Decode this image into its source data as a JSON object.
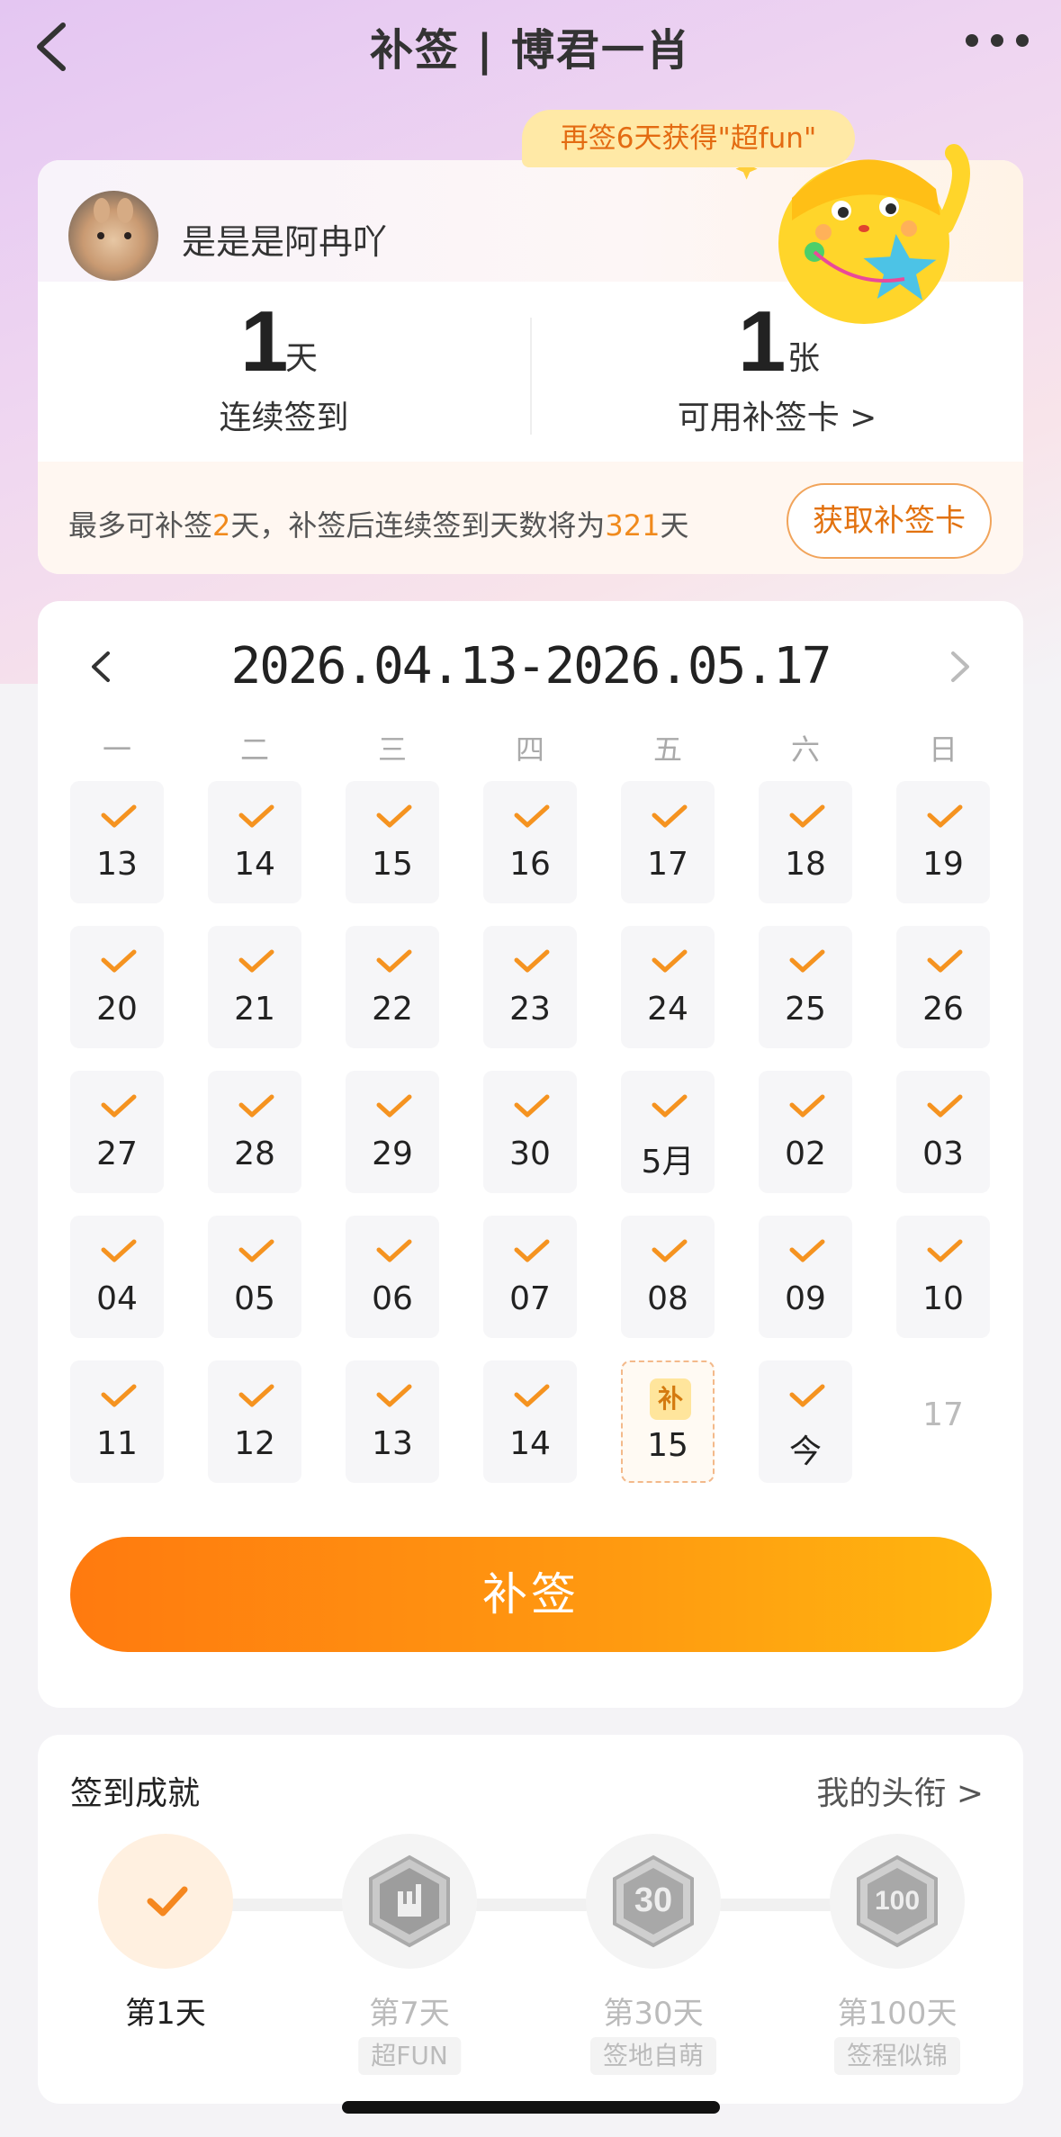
{
  "nav": {
    "title": "补签 | 博君一肖"
  },
  "promo": {
    "text": "再签6天获得\"超fun\""
  },
  "profile": {
    "username": "是是是阿冉吖",
    "streak_value": "1",
    "streak_unit": "天",
    "streak_label": "连续签到",
    "cards_value": "1",
    "cards_unit": "张",
    "cards_label": "可用补签卡 >"
  },
  "hint": {
    "p1": "最多可补签",
    "days": "2",
    "p2": "天，补签后连续签到天数将为",
    "total": "321",
    "p3": "天",
    "button": "获取补签卡"
  },
  "calendar": {
    "range": "2026.04.13-2026.05.17",
    "weekdays": [
      "一",
      "二",
      "三",
      "四",
      "五",
      "六",
      "日"
    ],
    "rows": [
      [
        {
          "label": "13",
          "state": "checked"
        },
        {
          "label": "14",
          "state": "checked"
        },
        {
          "label": "15",
          "state": "checked"
        },
        {
          "label": "16",
          "state": "checked"
        },
        {
          "label": "17",
          "state": "checked"
        },
        {
          "label": "18",
          "state": "checked"
        },
        {
          "label": "19",
          "state": "checked"
        }
      ],
      [
        {
          "label": "20",
          "state": "checked"
        },
        {
          "label": "21",
          "state": "checked"
        },
        {
          "label": "22",
          "state": "checked"
        },
        {
          "label": "23",
          "state": "checked"
        },
        {
          "label": "24",
          "state": "checked"
        },
        {
          "label": "25",
          "state": "checked"
        },
        {
          "label": "26",
          "state": "checked"
        }
      ],
      [
        {
          "label": "27",
          "state": "checked"
        },
        {
          "label": "28",
          "state": "checked"
        },
        {
          "label": "29",
          "state": "checked"
        },
        {
          "label": "30",
          "state": "checked"
        },
        {
          "label": "5月",
          "state": "checked"
        },
        {
          "label": "02",
          "state": "checked"
        },
        {
          "label": "03",
          "state": "checked"
        }
      ],
      [
        {
          "label": "04",
          "state": "checked"
        },
        {
          "label": "05",
          "state": "checked"
        },
        {
          "label": "06",
          "state": "checked"
        },
        {
          "label": "07",
          "state": "checked"
        },
        {
          "label": "08",
          "state": "checked"
        },
        {
          "label": "09",
          "state": "checked"
        },
        {
          "label": "10",
          "state": "checked"
        }
      ],
      [
        {
          "label": "11",
          "state": "checked"
        },
        {
          "label": "12",
          "state": "checked"
        },
        {
          "label": "13",
          "state": "checked"
        },
        {
          "label": "14",
          "state": "checked"
        },
        {
          "label": "15",
          "state": "makeup",
          "badge": "补"
        },
        {
          "label": "今",
          "state": "checked"
        },
        {
          "label": "17",
          "state": "future"
        }
      ]
    ],
    "main_button": "补签"
  },
  "achievements": {
    "title": "签到成就",
    "link": "我的头衔 >",
    "items": [
      {
        "day": "第1天",
        "tag": "",
        "done": true,
        "icon": "check-icon"
      },
      {
        "day": "第7天",
        "tag": "超FUN",
        "done": false,
        "icon": "rock-hand-badge-icon"
      },
      {
        "day": "第30天",
        "tag": "签地自萌",
        "done": false,
        "icon": "30-days-badge-icon"
      },
      {
        "day": "第100天",
        "tag": "签程似锦",
        "done": false,
        "icon": "100-days-badge-icon"
      }
    ]
  },
  "colors": {
    "accent": "#ff8a12",
    "check": "#f59320",
    "promo_bg": "#ffe9a6"
  }
}
